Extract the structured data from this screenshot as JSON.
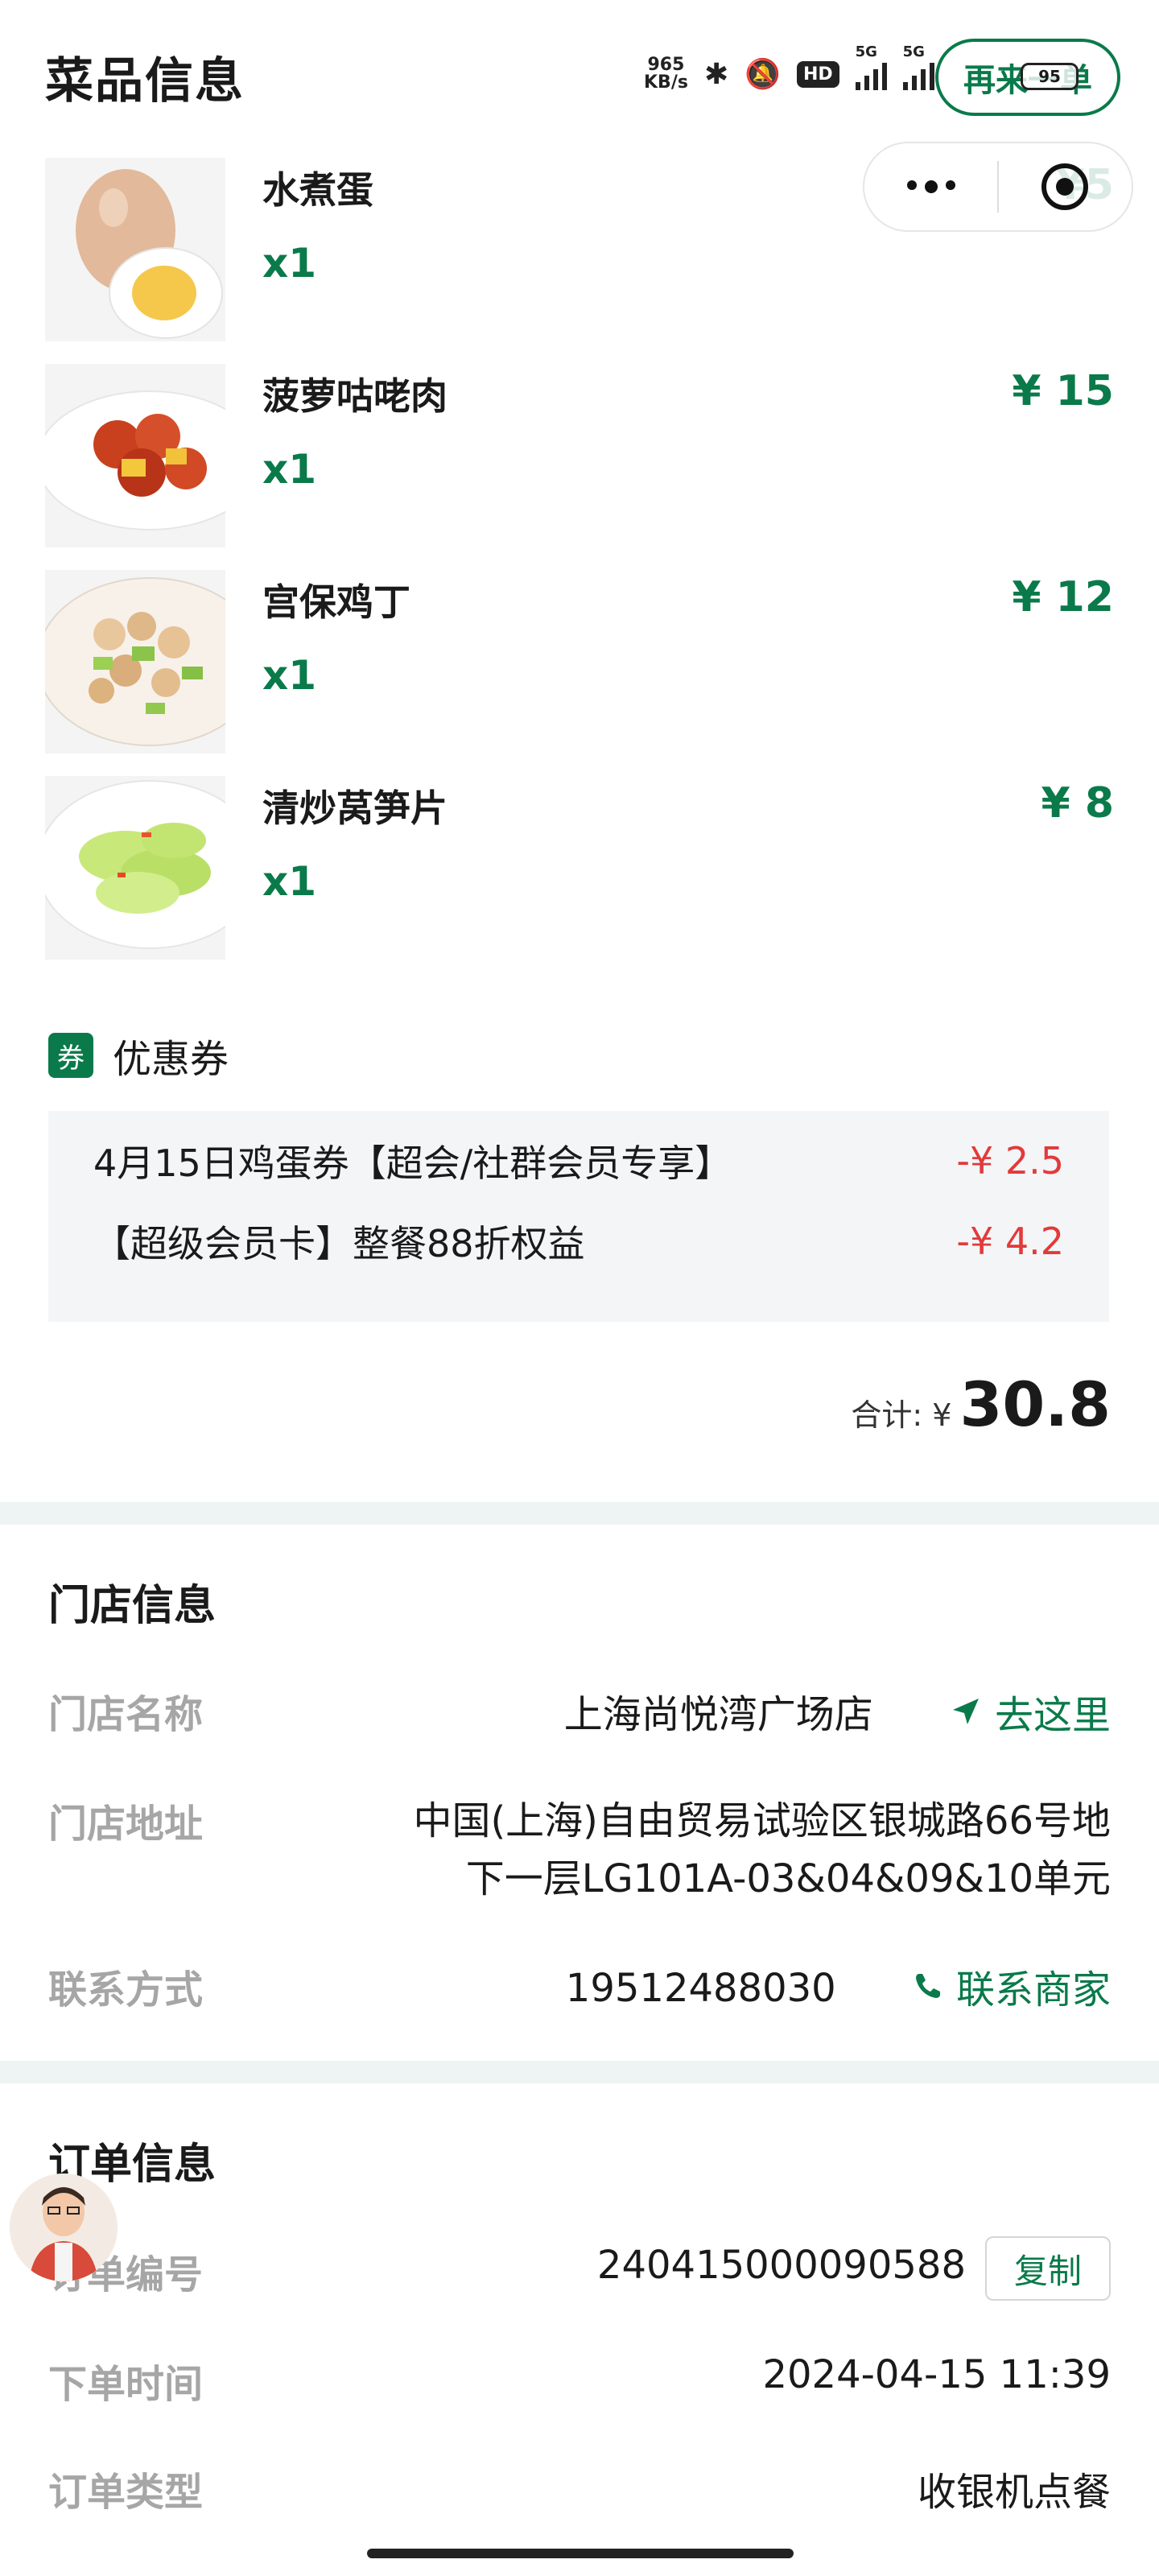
{
  "header": {
    "title": "菜品信息",
    "order_again_label": "再来一单",
    "status": {
      "net_speed": "965",
      "net_unit": "KB/s",
      "hd": "HD",
      "signal_label": "5G",
      "signal2_label": "5G",
      "battery": "95"
    }
  },
  "dishes": [
    {
      "name": "水煮蛋",
      "qty": "x1",
      "price": "¥5"
    },
    {
      "name": "菠萝咕咾肉",
      "qty": "x1",
      "price": "¥ 15"
    },
    {
      "name": "宫保鸡丁",
      "qty": "x1",
      "price": "¥ 12"
    },
    {
      "name": "清炒莴笋片",
      "qty": "x1",
      "price": "¥ 8"
    }
  ],
  "coupons": {
    "badge": "券",
    "title": "优惠券",
    "items": [
      {
        "name": "4月15日鸡蛋券【超会/社群会员专享】",
        "amount": "-¥ 2.5"
      },
      {
        "name": "【超级会员卡】整餐88折权益",
        "amount": "-¥ 4.2"
      }
    ]
  },
  "total": {
    "label": "合计: ¥",
    "value": "30.8"
  },
  "store": {
    "title": "门店信息",
    "name_label": "门店名称",
    "name": "上海尚悦湾广场店",
    "nav_label": "去这里",
    "address_label": "门店地址",
    "address_line1": "中国(上海)自由贸易试验区银城路66号地",
    "address_line2": "下一层LG101A-03&04&09&10单元",
    "contact_label": "联系方式",
    "phone": "19512488030",
    "contact_button": "联系商家"
  },
  "order": {
    "title": "订单信息",
    "number_label": "订单编号",
    "number": "240415000090588",
    "copy_label": "复制",
    "time_label": "下单时间",
    "time": "2024-04-15 11:39",
    "type_label": "订单类型",
    "type": "收银机点餐"
  },
  "colors": {
    "accent": "#0a7a4a",
    "discount": "#e23a3a",
    "label_gray": "#a6a6a6",
    "section_bg": "#f3f5f7"
  }
}
